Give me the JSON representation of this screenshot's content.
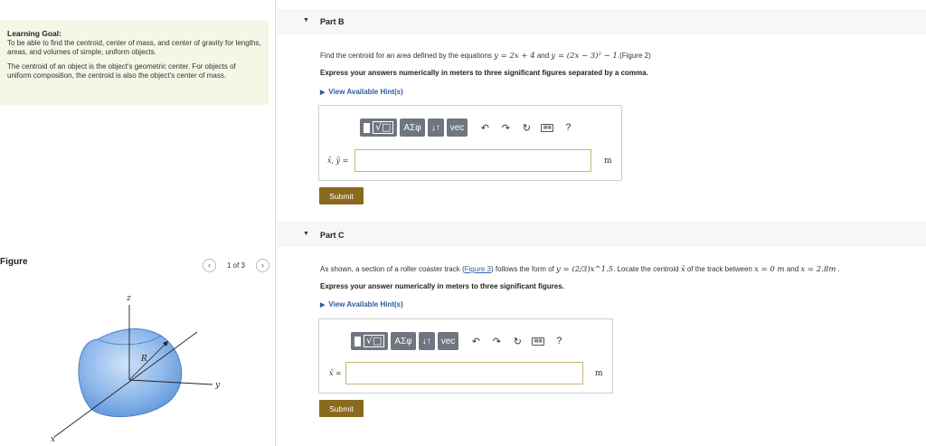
{
  "learning_goal": {
    "title": "Learning Goal:",
    "text1": "To be able to find the centroid, center of mass, and center of gravity for lengths, areas, and volumes of simple, uniform objects.",
    "text2": "The centroid of an object is the object's geometric center. For objects of uniform composition, the centroid is also the object's center of mass."
  },
  "figure": {
    "label": "Figure",
    "pager_text": "1 of 3",
    "prev_icon": "chevron-left-icon",
    "next_icon": "chevron-right-icon",
    "axis_z": "z",
    "axis_y": "y",
    "axis_x": "x",
    "radius_label": "R",
    "shape_color": "#8fb8ea"
  },
  "part_b": {
    "title": "Part B",
    "question_pre": "Find the centroid for an area defined by the equations ",
    "eq1": "y = 2x + 4",
    "question_mid": " and ",
    "eq2": "y = (2x − 3)² − 1",
    "question_post": ".",
    "figure_link": "(Figure 2)",
    "instruction": "Express your answers numerically in meters to three significant figures separated by a comma.",
    "hint": "View Available Hint(s)",
    "answer_label": "x̄, ȳ =",
    "unit": "m",
    "submit": "Submit"
  },
  "part_c": {
    "title": "Part C",
    "question_pre": "As shown, a section of a roller coaster track (",
    "figure_link": "Figure 3",
    "question_mid": ") follows the form of ",
    "eq1": "y = (2/3)x^1.5",
    "question_post1": ". Locate the centroid ",
    "xbar": "x̄",
    "question_post2": " of the track between ",
    "eq2": "x = 0 m",
    "question_and": " and ",
    "eq3": "x = 2.8m",
    "question_end": " .",
    "instruction": "Express your answer numerically in meters to three significant figures.",
    "hint": "View Available Hint(s)",
    "answer_label": "x̄ =",
    "unit": "m",
    "submit": "Submit"
  },
  "toolbar": {
    "greek": "ΑΣφ",
    "arrows": "↓↑",
    "vec": "vec",
    "help": "?"
  },
  "colors": {
    "accent": "#8a6a1e",
    "hint": "#2b5c9e",
    "goal_bg": "#f4f6e6"
  }
}
